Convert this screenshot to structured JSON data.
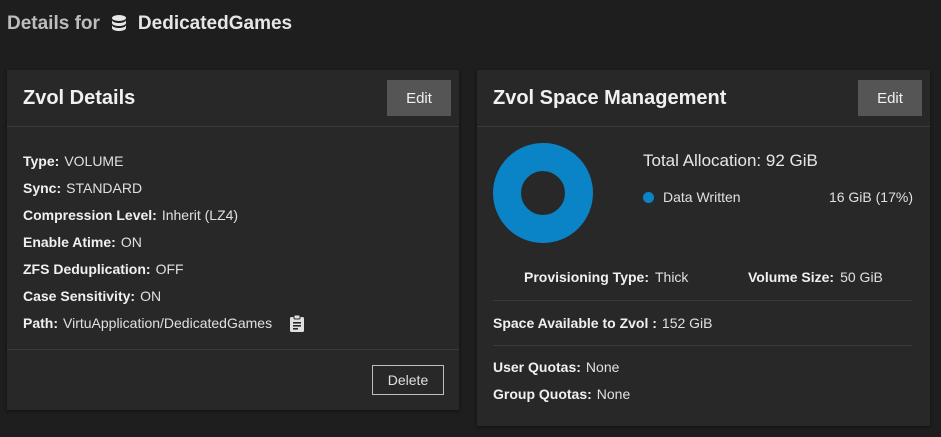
{
  "header": {
    "prefix": "Details for",
    "dataset_name": "DedicatedGames"
  },
  "zvol_details": {
    "title": "Zvol Details",
    "edit_label": "Edit",
    "delete_label": "Delete",
    "rows": [
      {
        "label": "Type:",
        "value": "VOLUME"
      },
      {
        "label": "Sync:",
        "value": "STANDARD"
      },
      {
        "label": "Compression Level:",
        "value": "Inherit (LZ4)"
      },
      {
        "label": "Enable Atime:",
        "value": "ON"
      },
      {
        "label": "ZFS Deduplication:",
        "value": "OFF"
      },
      {
        "label": "Case Sensitivity:",
        "value": "ON"
      },
      {
        "label": "Path:",
        "value": "VirtuApplication/DedicatedGames"
      }
    ]
  },
  "space_management": {
    "title": "Zvol Space Management",
    "edit_label": "Edit",
    "total_allocation_label": "Total Allocation:",
    "total_allocation_value": "92 GiB",
    "legend": {
      "label": "Data Written",
      "value": "16 GiB (17%)",
      "fraction": 0.17,
      "color": "#0a84c6"
    },
    "provisioning_type_label": "Provisioning Type:",
    "provisioning_type_value": "Thick",
    "volume_size_label": "Volume Size:",
    "volume_size_value": "50 GiB",
    "space_available_label": "Space Available to Zvol :",
    "space_available_value": "152 GiB",
    "user_quotas_label": "User Quotas:",
    "user_quotas_value": "None",
    "group_quotas_label": "Group Quotas:",
    "group_quotas_value": "None"
  },
  "colors": {
    "background": "#1e1e1e",
    "card": "#282828",
    "button": "#555555",
    "accent": "#0a84c6"
  },
  "icons": {
    "dataset": "database-icon",
    "copy": "clipboard-icon"
  }
}
